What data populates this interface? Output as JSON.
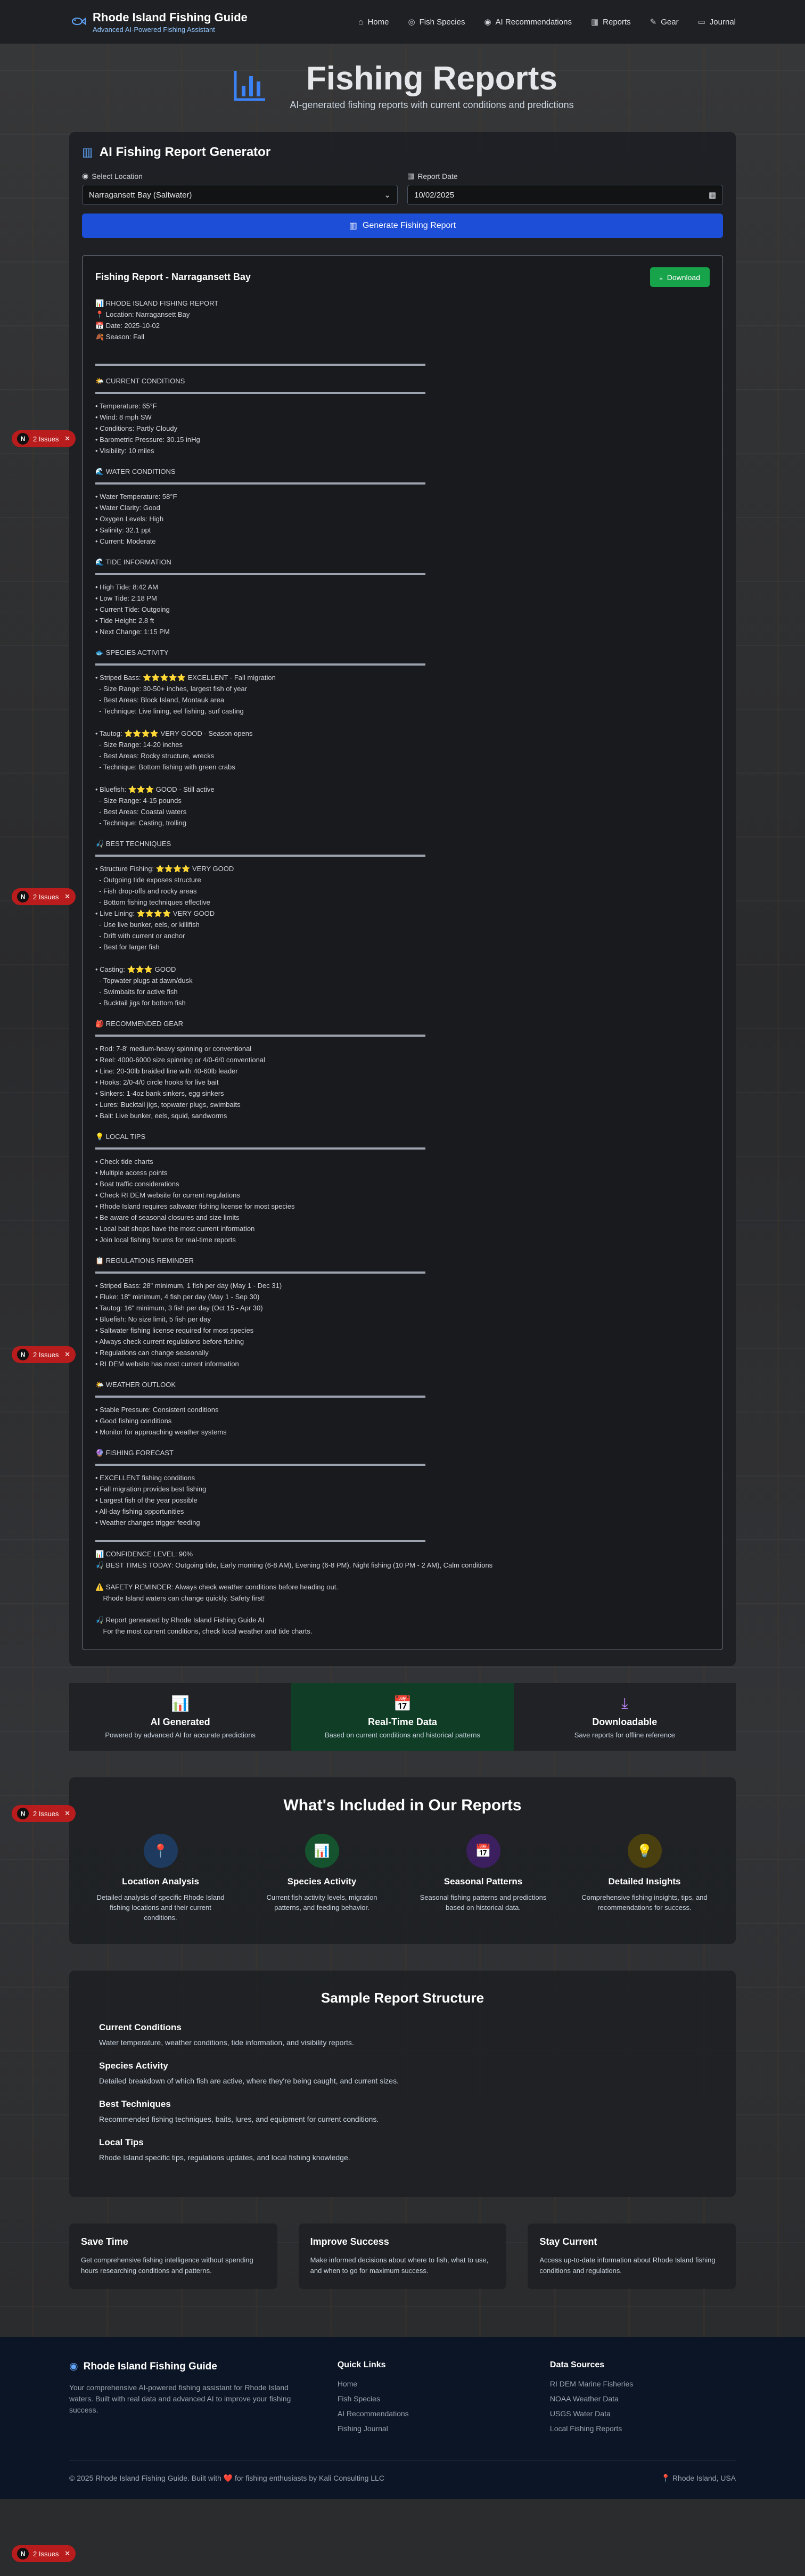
{
  "nav": {
    "brand_title": "Rhode Island Fishing Guide",
    "brand_sub": "Advanced AI-Powered Fishing Assistant",
    "links": [
      {
        "label": "Home",
        "icon": "home-icon"
      },
      {
        "label": "Fish Species",
        "icon": "fish-icon"
      },
      {
        "label": "AI Recommendations",
        "icon": "ai-icon"
      },
      {
        "label": "Reports",
        "icon": "chart-icon"
      },
      {
        "label": "Gear",
        "icon": "gear-icon"
      },
      {
        "label": "Journal",
        "icon": "journal-icon"
      }
    ]
  },
  "hero": {
    "title": "Fishing Reports",
    "subtitle": "AI-generated fishing reports with current conditions and predictions"
  },
  "generator": {
    "title": "AI Fishing Report Generator",
    "location_label": "Select Location",
    "location_value": "Narragansett Bay (Saltwater)",
    "date_label": "Report Date",
    "date_value": "10/02/2025",
    "generate_label": "Generate Fishing Report"
  },
  "report": {
    "title": "Fishing Report - Narragansett Bay",
    "download_label": "Download",
    "intro": "📊 RHODE ISLAND FISHING REPORT\n📍 Location: Narragansett Bay\n📅 Date: 2025-10-02\n🍂 Season: Fall",
    "sections": [
      {
        "heading": "🌤️ CURRENT CONDITIONS",
        "body": "• Temperature: 65°F\n• Wind: 8 mph SW\n• Conditions: Partly Cloudy\n• Barometric Pressure: 30.15 inHg\n• Visibility: 10 miles"
      },
      {
        "heading": "🌊 WATER CONDITIONS",
        "body": "• Water Temperature: 58°F\n• Water Clarity: Good\n• Oxygen Levels: High\n• Salinity: 32.1 ppt\n• Current: Moderate"
      },
      {
        "heading": "🌊 TIDE INFORMATION",
        "body": "• High Tide: 8:42 AM\n• Low Tide: 2:18 PM\n• Current Tide: Outgoing\n• Tide Height: 2.8 ft\n• Next Change: 1:15 PM"
      },
      {
        "heading": "🐟 SPECIES ACTIVITY",
        "body": "• Striped Bass: ⭐⭐⭐⭐⭐ EXCELLENT - Fall migration\n  - Size Range: 30-50+ inches, largest fish of year\n  - Best Areas: Block Island, Montauk area\n  - Technique: Live lining, eel fishing, surf casting\n\n• Tautog: ⭐⭐⭐⭐ VERY GOOD - Season opens\n  - Size Range: 14-20 inches\n  - Best Areas: Rocky structure, wrecks\n  - Technique: Bottom fishing with green crabs\n\n• Bluefish: ⭐⭐⭐ GOOD - Still active\n  - Size Range: 4-15 pounds\n  - Best Areas: Coastal waters\n  - Technique: Casting, trolling"
      },
      {
        "heading": "🎣 BEST TECHNIQUES",
        "body": "• Structure Fishing: ⭐⭐⭐⭐ VERY GOOD\n  - Outgoing tide exposes structure\n  - Fish drop-offs and rocky areas\n  - Bottom fishing techniques effective\n• Live Lining: ⭐⭐⭐⭐ VERY GOOD\n  - Use live bunker, eels, or killifish\n  - Drift with current or anchor\n  - Best for larger fish\n\n• Casting: ⭐⭐⭐ GOOD\n  - Topwater plugs at dawn/dusk\n  - Swimbaits for active fish\n  - Bucktail jigs for bottom fish"
      },
      {
        "heading": "🎒 RECOMMENDED GEAR",
        "body": "• Rod: 7-8' medium-heavy spinning or conventional\n• Reel: 4000-6000 size spinning or 4/0-6/0 conventional\n• Line: 20-30lb braided line with 40-60lb leader\n• Hooks: 2/0-4/0 circle hooks for live bait\n• Sinkers: 1-4oz bank sinkers, egg sinkers\n• Lures: Bucktail jigs, topwater plugs, swimbaits\n• Bait: Live bunker, eels, squid, sandworms"
      },
      {
        "heading": "💡 LOCAL TIPS",
        "body": "• Check tide charts\n• Multiple access points\n• Boat traffic considerations\n• Check RI DEM website for current regulations\n• Rhode Island requires saltwater fishing license for most species\n• Be aware of seasonal closures and size limits\n• Local bait shops have the most current information\n• Join local fishing forums for real-time reports"
      },
      {
        "heading": "📋 REGULATIONS REMINDER",
        "body": "• Striped Bass: 28\" minimum, 1 fish per day (May 1 - Dec 31)\n• Fluke: 18\" minimum, 4 fish per day (May 1 - Sep 30)\n• Tautog: 16\" minimum, 3 fish per day (Oct 15 - Apr 30)\n• Bluefish: No size limit, 5 fish per day\n• Saltwater fishing license required for most species\n• Always check current regulations before fishing\n• Regulations can change seasonally\n• RI DEM website has most current information"
      },
      {
        "heading": "🌤️ WEATHER OUTLOOK",
        "body": "• Stable Pressure: Consistent conditions\n• Good fishing conditions\n• Monitor for approaching weather systems"
      },
      {
        "heading": "🔮 FISHING FORECAST",
        "body": "• EXCELLENT fishing conditions\n• Fall migration provides best fishing\n• Largest fish of the year possible\n• All-day fishing opportunities\n• Weather changes trigger feeding"
      }
    ],
    "confidence": "📊 CONFIDENCE LEVEL: 90%\n🎣 BEST TIMES TODAY: Outgoing tide, Early morning (6-8 AM), Evening (6-8 PM), Night fishing (10 PM - 2 AM), Calm conditions",
    "safety": "⚠️ SAFETY REMINDER: Always check weather conditions before heading out.\n    Rhode Island waters can change quickly. Safety first!",
    "footer_note": "🎣 Report generated by Rhode Island Fishing Guide AI\n    For the most current conditions, check local weather and tide charts."
  },
  "strip": [
    {
      "icon": "📊",
      "title": "AI Generated",
      "desc": "Powered by advanced AI for accurate predictions",
      "color": "#60a5fa"
    },
    {
      "icon": "📅",
      "title": "Real-Time Data",
      "desc": "Based on current conditions and historical patterns",
      "color": "#4ade80"
    },
    {
      "icon": "⤓",
      "title": "Downloadable",
      "desc": "Save reports for offline reference",
      "color": "#c084fc"
    }
  ],
  "included": {
    "title": "What's Included in Our Reports",
    "items": [
      {
        "icon": "📍",
        "bg": "#1e3a5f",
        "color": "#60a5fa",
        "title": "Location Analysis",
        "desc": "Detailed analysis of specific Rhode Island fishing locations and their current conditions."
      },
      {
        "icon": "📊",
        "bg": "#14532d",
        "color": "#4ade80",
        "title": "Species Activity",
        "desc": "Current fish activity levels, migration patterns, and feeding behavior."
      },
      {
        "icon": "📅",
        "bg": "#3b1f5e",
        "color": "#c084fc",
        "title": "Seasonal Patterns",
        "desc": "Seasonal fishing patterns and predictions based on historical data."
      },
      {
        "icon": "💡",
        "bg": "#4a3f0f",
        "color": "#facc15",
        "title": "Detailed Insights",
        "desc": "Comprehensive fishing insights, tips, and recommendations for success."
      }
    ]
  },
  "sample": {
    "title": "Sample Report Structure",
    "items": [
      {
        "title": "Current Conditions",
        "desc": "Water temperature, weather conditions, tide information, and visibility reports."
      },
      {
        "title": "Species Activity",
        "desc": "Detailed breakdown of which fish are active, where they're being caught, and current sizes."
      },
      {
        "title": "Best Techniques",
        "desc": "Recommended fishing techniques, baits, lures, and equipment for current conditions."
      },
      {
        "title": "Local Tips",
        "desc": "Rhode Island specific tips, regulations updates, and local fishing knowledge."
      }
    ]
  },
  "benefits": [
    {
      "title": "Save Time",
      "desc": "Get comprehensive fishing intelligence without spending hours researching conditions and patterns."
    },
    {
      "title": "Improve Success",
      "desc": "Make informed decisions about where to fish, what to use, and when to go for maximum success."
    },
    {
      "title": "Stay Current",
      "desc": "Access up-to-date information about Rhode Island fishing conditions and regulations."
    }
  ],
  "footer": {
    "brand": "Rhode Island Fishing Guide",
    "desc": "Your comprehensive AI-powered fishing assistant for Rhode Island waters. Built with real data and advanced AI to improve your fishing success.",
    "quick_title": "Quick Links",
    "quick_links": [
      "Home",
      "Fish Species",
      "AI Recommendations",
      "Fishing Journal"
    ],
    "sources_title": "Data Sources",
    "sources": [
      "RI DEM Marine Fisheries",
      "NOAA Weather Data",
      "USGS Water Data",
      "Local Fishing Reports"
    ],
    "copyright": "© 2025 Rhode Island Fishing Guide. Built with ❤️ for fishing enthusiasts by Kali Consulting LLC",
    "location": "📍 Rhode Island, USA"
  },
  "issues": {
    "label": "2 Issues",
    "letter": "N"
  },
  "colors": {
    "accent": "#1d4ed8",
    "download": "#16a34a",
    "issue": "#b91c1c",
    "footer_bg": "#0c1525"
  }
}
